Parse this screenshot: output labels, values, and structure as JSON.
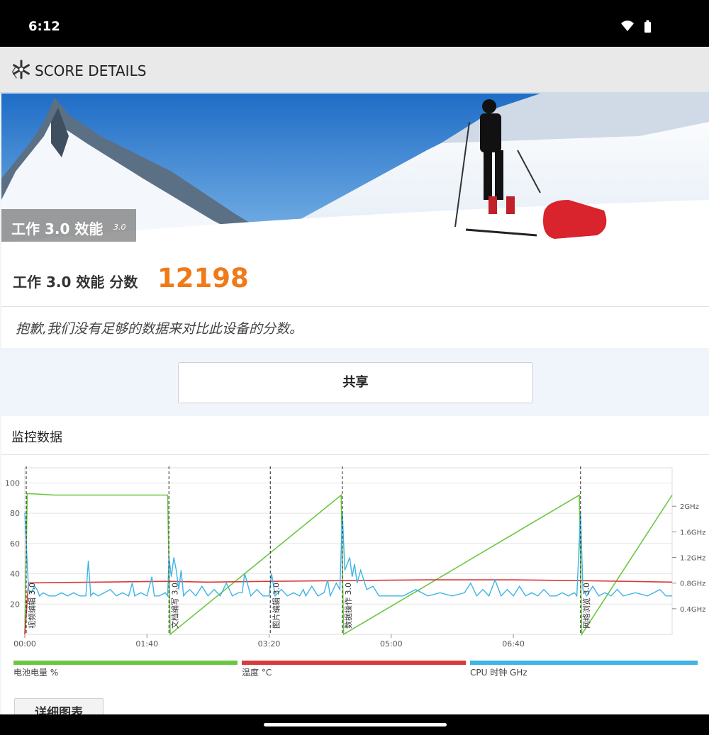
{
  "status": {
    "time": "6:12"
  },
  "appbar": {
    "back": "〈",
    "title": "SCORE DETAILS"
  },
  "hero": {
    "title": "工作 3.0 效能",
    "version": "3.0"
  },
  "score": {
    "label": "工作 3.0 效能 分数",
    "value": "12198",
    "note": "抱歉,我们没有足够的数据来对比此设备的分数。"
  },
  "share": {
    "label": "共享"
  },
  "monitor": {
    "title": "监控数据",
    "detail_button": "详细图表"
  },
  "colors": {
    "accent": "#f07a1a",
    "battery": "#6cc644",
    "temperature": "#d93a3a",
    "cpu": "#3fb4e6"
  },
  "chart_data": {
    "type": "line",
    "x_ticks": [
      "00:00",
      "01:40",
      "03:20",
      "05:00",
      "06:40"
    ],
    "y_ticks_left": [
      "100",
      "80",
      "60",
      "40",
      "20"
    ],
    "y_ticks_right": [
      "2GHz",
      "1.6GHz",
      "1.2GHz",
      "0.8GHz",
      "0.4GHz"
    ],
    "ylim": [
      0,
      100
    ],
    "xlim_seconds": [
      0,
      530
    ],
    "segments": [
      {
        "label": "视频编辑 3.0",
        "start": 0
      },
      {
        "label": "文档编写 3.0",
        "start": 118
      },
      {
        "label": "图片编辑 3.0",
        "start": 201
      },
      {
        "label": "数据操作 3.0",
        "start": 260
      },
      {
        "label": "网络浏览 3.0",
        "start": 455
      }
    ],
    "series": [
      {
        "name": "电池电量 %",
        "x": [
          0,
          2,
          25,
          117,
          119,
          259,
          261,
          454,
          456,
          530
        ],
        "values": [
          0,
          93,
          92,
          92,
          0,
          92,
          0,
          92,
          0,
          92
        ]
      },
      {
        "name": "温度 °C",
        "x": [
          0,
          3,
          60,
          118,
          150,
          200,
          260,
          330,
          400,
          455,
          530
        ],
        "values": [
          0,
          34,
          34.5,
          35,
          34.5,
          35,
          35.5,
          36,
          36,
          35.5,
          34.5
        ]
      },
      {
        "name": "CPU 时钟 GHz",
        "x": [
          0,
          3,
          5,
          8,
          10,
          12,
          15,
          20,
          25,
          30,
          35,
          40,
          45,
          50,
          52,
          54,
          56,
          60,
          65,
          70,
          75,
          80,
          85,
          88,
          90,
          95,
          100,
          104,
          106,
          110,
          115,
          117,
          118,
          120,
          122,
          124,
          126,
          128,
          130,
          132,
          135,
          140,
          145,
          150,
          155,
          160,
          165,
          170,
          175,
          178,
          180,
          185,
          190,
          195,
          200,
          202,
          205,
          210,
          215,
          220,
          225,
          228,
          230,
          235,
          240,
          245,
          248,
          250,
          255,
          258,
          260,
          262,
          264,
          266,
          268,
          270,
          272,
          275,
          280,
          285,
          290,
          295,
          300,
          310,
          320,
          330,
          340,
          350,
          360,
          365,
          370,
          375,
          380,
          385,
          390,
          395,
          400,
          405,
          410,
          415,
          420,
          425,
          430,
          435,
          440,
          445,
          450,
          452,
          455,
          457,
          460,
          465,
          470,
          475,
          480,
          485,
          490,
          500,
          510,
          520,
          525,
          530
        ],
        "values": [
          1.9,
          0.7,
          0.65,
          0.75,
          0.7,
          0.6,
          0.65,
          0.6,
          0.6,
          0.65,
          0.6,
          0.65,
          0.6,
          0.6,
          1.15,
          0.6,
          0.65,
          0.6,
          0.65,
          0.7,
          0.6,
          0.65,
          0.6,
          0.8,
          0.6,
          0.65,
          0.6,
          0.9,
          0.6,
          0.6,
          0.65,
          0.6,
          1.2,
          0.9,
          1.2,
          1.0,
          0.7,
          1.0,
          0.6,
          0.65,
          0.7,
          0.6,
          0.75,
          0.6,
          0.7,
          0.6,
          0.8,
          0.6,
          0.65,
          0.65,
          0.95,
          0.6,
          0.7,
          0.6,
          0.6,
          0.95,
          0.6,
          0.7,
          0.6,
          0.65,
          0.6,
          0.7,
          0.6,
          0.75,
          0.6,
          0.65,
          0.85,
          0.6,
          0.8,
          0.7,
          1.9,
          1.0,
          1.1,
          1.2,
          0.9,
          1.1,
          0.8,
          1.0,
          0.7,
          0.75,
          0.6,
          0.6,
          0.6,
          0.6,
          0.7,
          0.6,
          0.65,
          0.6,
          0.65,
          0.8,
          0.6,
          0.7,
          0.6,
          0.85,
          0.6,
          0.7,
          0.6,
          0.75,
          0.6,
          0.65,
          0.6,
          0.7,
          0.6,
          0.6,
          0.65,
          0.6,
          0.65,
          0.6,
          1.9,
          0.7,
          0.6,
          0.75,
          0.6,
          0.65,
          0.6,
          0.7,
          0.6,
          0.65,
          0.6,
          0.7,
          0.6,
          0.6
        ]
      }
    ],
    "legend": [
      "电池电量 %",
      "温度 °C",
      "CPU 时钟 GHz"
    ]
  }
}
